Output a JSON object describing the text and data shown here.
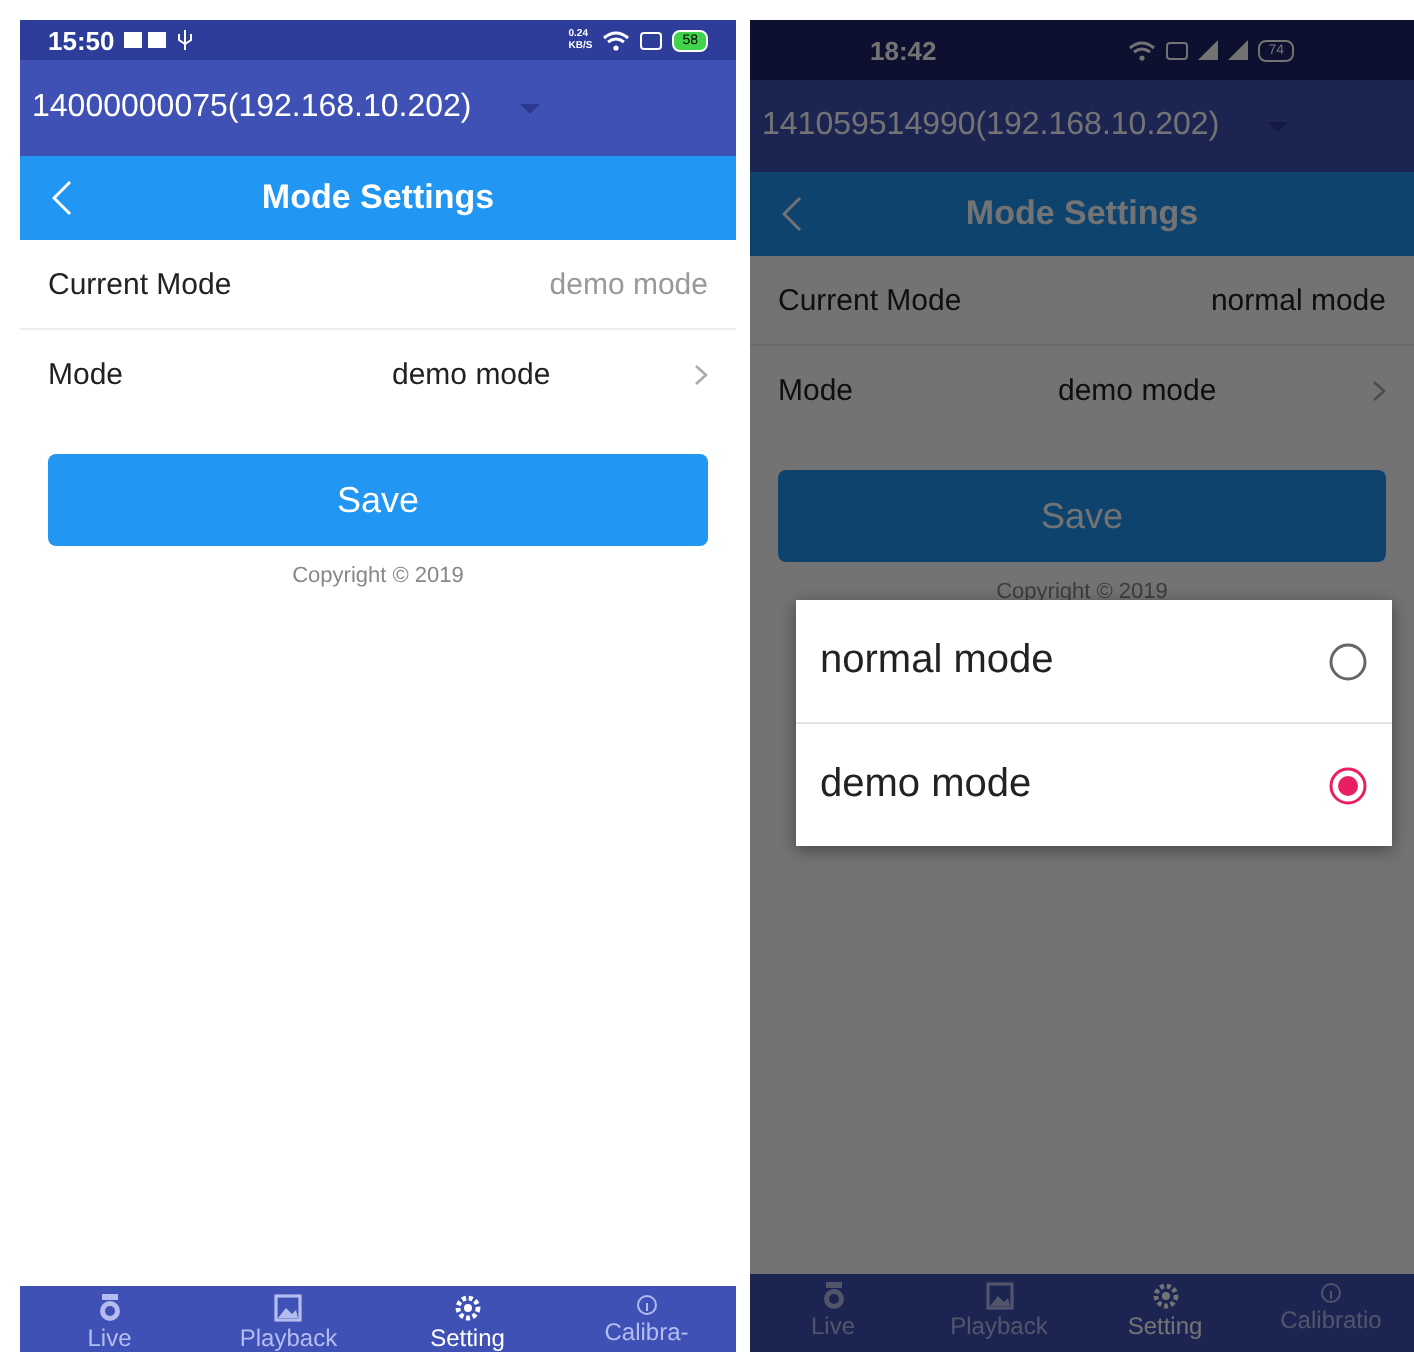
{
  "screens": [
    {
      "status_bar": {
        "time": "15:50",
        "net_speed": "0.24",
        "net_unit": "KB/S",
        "battery": "58"
      },
      "device": {
        "label": "14000000075(192.168.10.202)"
      },
      "header": {
        "title": "Mode Settings"
      },
      "current_mode": {
        "label": "Current Mode",
        "value": "demo mode"
      },
      "mode": {
        "label": "Mode",
        "value": "demo mode"
      },
      "save": "Save",
      "copyright": "Copyright © 2019",
      "nav": [
        {
          "label": "Live",
          "selected": false
        },
        {
          "label": "Playback",
          "selected": false
        },
        {
          "label": "Setting",
          "selected": true
        },
        {
          "label": "Calibra-",
          "selected": false
        }
      ]
    },
    {
      "status_bar": {
        "time": "18:42",
        "battery": "74"
      },
      "device": {
        "label": "141059514990(192.168.10.202)"
      },
      "header": {
        "title": "Mode Settings"
      },
      "current_mode": {
        "label": "Current Mode",
        "value": "normal mode"
      },
      "mode": {
        "label": "Mode",
        "value": "demo mode"
      },
      "save": "Save",
      "copyright": "Copyright © 2019",
      "nav": [
        {
          "label": "Live",
          "selected": false
        },
        {
          "label": "Playback",
          "selected": false
        },
        {
          "label": "Setting",
          "selected": true
        },
        {
          "label": "Calibratio",
          "selected": false
        }
      ],
      "dialog": {
        "options": [
          {
            "label": "normal mode",
            "selected": false
          },
          {
            "label": "demo mode",
            "selected": true
          }
        ]
      }
    }
  ]
}
